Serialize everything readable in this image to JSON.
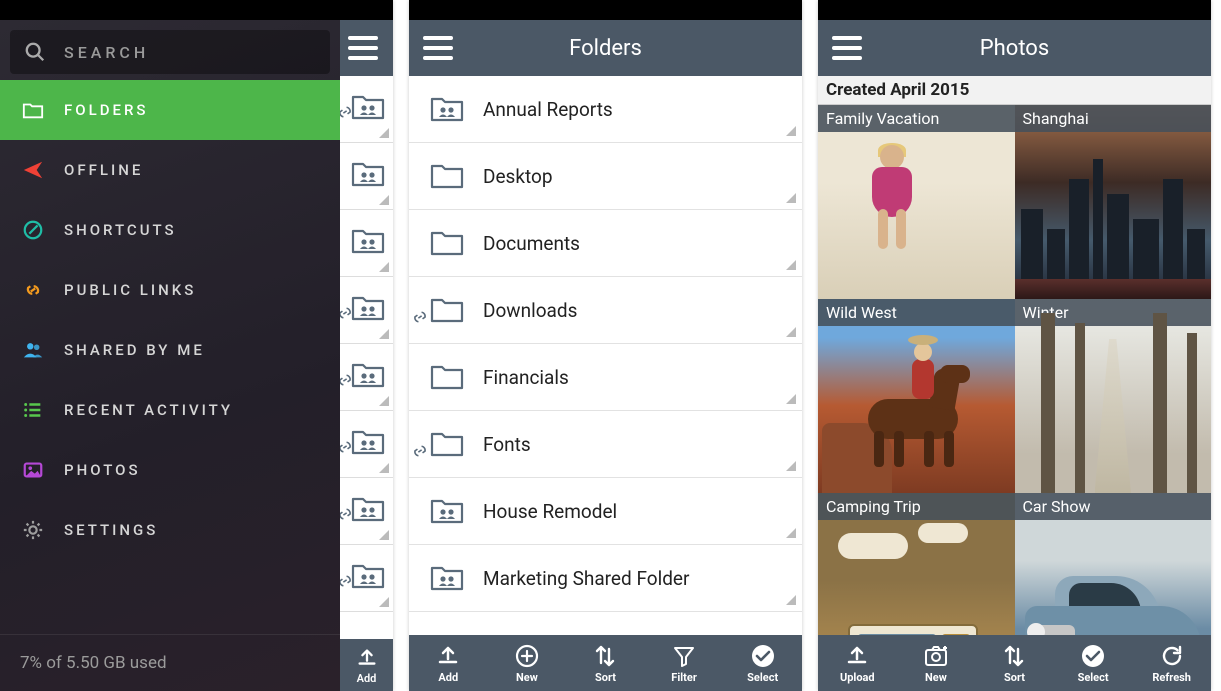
{
  "screen1": {
    "search_placeholder": "SEARCH",
    "nav": [
      {
        "label": "FOLDERS"
      },
      {
        "label": "OFFLINE"
      },
      {
        "label": "SHORTCUTS"
      },
      {
        "label": "PUBLIC LINKS"
      },
      {
        "label": "SHARED BY ME"
      },
      {
        "label": "RECENT ACTIVITY"
      },
      {
        "label": "PHOTOS"
      },
      {
        "label": "SETTINGS"
      }
    ],
    "storage_text": "7% of 5.50 GB used",
    "partial_action_label": "Add"
  },
  "screen2": {
    "title": "Folders",
    "folders": [
      {
        "name": "Annual Reports",
        "shared": true,
        "link": false
      },
      {
        "name": "Desktop",
        "shared": false,
        "link": false
      },
      {
        "name": "Documents",
        "shared": false,
        "link": false
      },
      {
        "name": "Downloads",
        "shared": false,
        "link": true
      },
      {
        "name": "Financials",
        "shared": false,
        "link": false
      },
      {
        "name": "Fonts",
        "shared": false,
        "link": true
      },
      {
        "name": "House Remodel",
        "shared": true,
        "link": false
      },
      {
        "name": "Marketing Shared Folder",
        "shared": true,
        "link": false
      }
    ],
    "actions": [
      "Add",
      "New",
      "Sort",
      "Filter",
      "Select"
    ]
  },
  "screen3": {
    "title": "Photos",
    "group_header": "Created April 2015",
    "photos": [
      {
        "caption": "Family Vacation"
      },
      {
        "caption": "Shanghai"
      },
      {
        "caption": "Wild West"
      },
      {
        "caption": "Winter"
      },
      {
        "caption": "Camping Trip"
      },
      {
        "caption": "Car Show"
      }
    ],
    "actions": [
      "Upload",
      "New",
      "Sort",
      "Select",
      "Refresh"
    ]
  }
}
